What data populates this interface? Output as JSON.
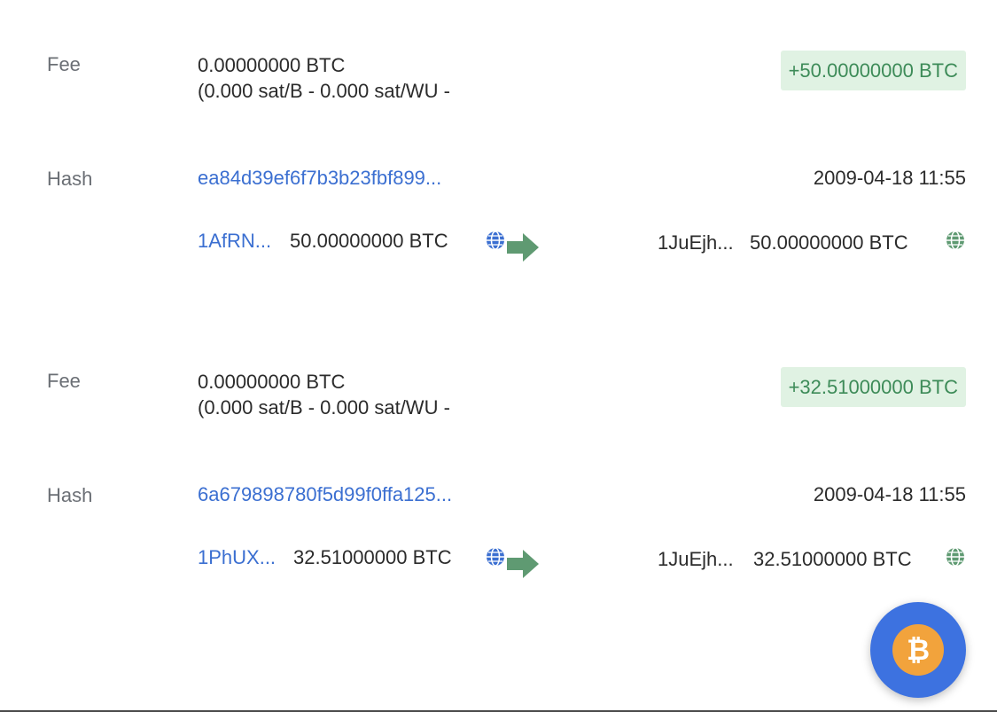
{
  "transactions": [
    {
      "fee_label": "Fee",
      "fee_value": "0.00000000 BTC",
      "fee_rate": "(0.000 sat/B - 0.000 sat/WU -",
      "amount": "+50.00000000 BTC",
      "hash_label": "Hash",
      "hash": "ea84d39ef6f7b3b23fbf899...",
      "timestamp": "2009-04-18 11:55",
      "input_address": "1AfRN...",
      "input_amount": "50.00000000 BTC",
      "output_address": "1JuEjh...",
      "output_amount": "50.00000000 BTC"
    },
    {
      "fee_label": "Fee",
      "fee_value": "0.00000000 BTC",
      "fee_rate": "(0.000 sat/B - 0.000 sat/WU -",
      "amount": "+32.51000000 BTC",
      "hash_label": "Hash",
      "hash": "6a679898780f5d99f0ffa125...",
      "timestamp": "2009-04-18 11:55",
      "input_address": "1PhUX...",
      "input_amount": "32.51000000 BTC",
      "output_address": "1JuEjh...",
      "output_amount": "32.51000000 BTC"
    }
  ],
  "fab": {
    "icon": "bitcoin-icon",
    "symbol": "₿"
  },
  "colors": {
    "link": "#3b6fd1",
    "positive_badge_bg": "#e0f2e3",
    "positive_badge_text": "#3d8b58",
    "arrow": "#5f9a72",
    "fab_bg": "#3d72e0",
    "coin": "#f2a33c"
  }
}
